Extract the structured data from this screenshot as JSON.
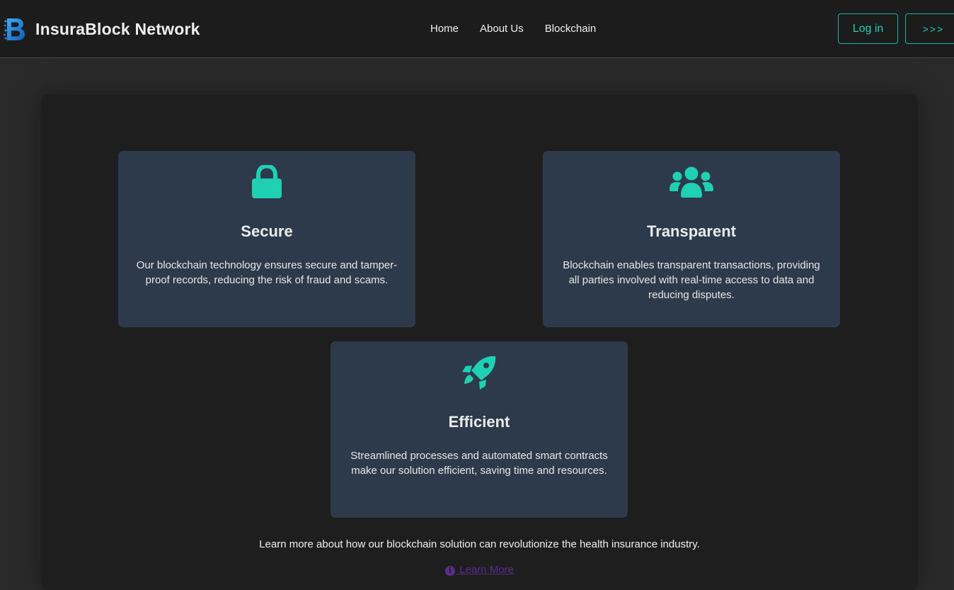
{
  "header": {
    "brand_name": "InsuraBlock Network",
    "nav": [
      {
        "label": "Home"
      },
      {
        "label": "About Us"
      },
      {
        "label": "Blockchain"
      }
    ],
    "login_label": "Log in",
    "more_label": ">>>"
  },
  "features": [
    {
      "icon": "lock-icon",
      "title": "Secure",
      "text": "Our blockchain technology ensures secure and tamper-proof records, reducing the risk of fraud and scams."
    },
    {
      "icon": "users-icon",
      "title": "Transparent",
      "text": "Blockchain enables transparent transactions, providing all parties involved with real-time access to data and reducing disputes."
    },
    {
      "icon": "rocket-icon",
      "title": "Efficient",
      "text": "Streamlined processes and automated smart contracts make our solution efficient, saving time and resources."
    }
  ],
  "footer": {
    "learn_text": "Learn more about how our blockchain solution can revolutionize the health insurance industry.",
    "learn_link": " Learn More"
  },
  "colors": {
    "accent": "#1fd0b3",
    "card_bg": "#2c3a4c",
    "panel_bg": "#1e1e1e",
    "nav_bg": "#1c1c1d",
    "link": "#5a2d8f"
  }
}
